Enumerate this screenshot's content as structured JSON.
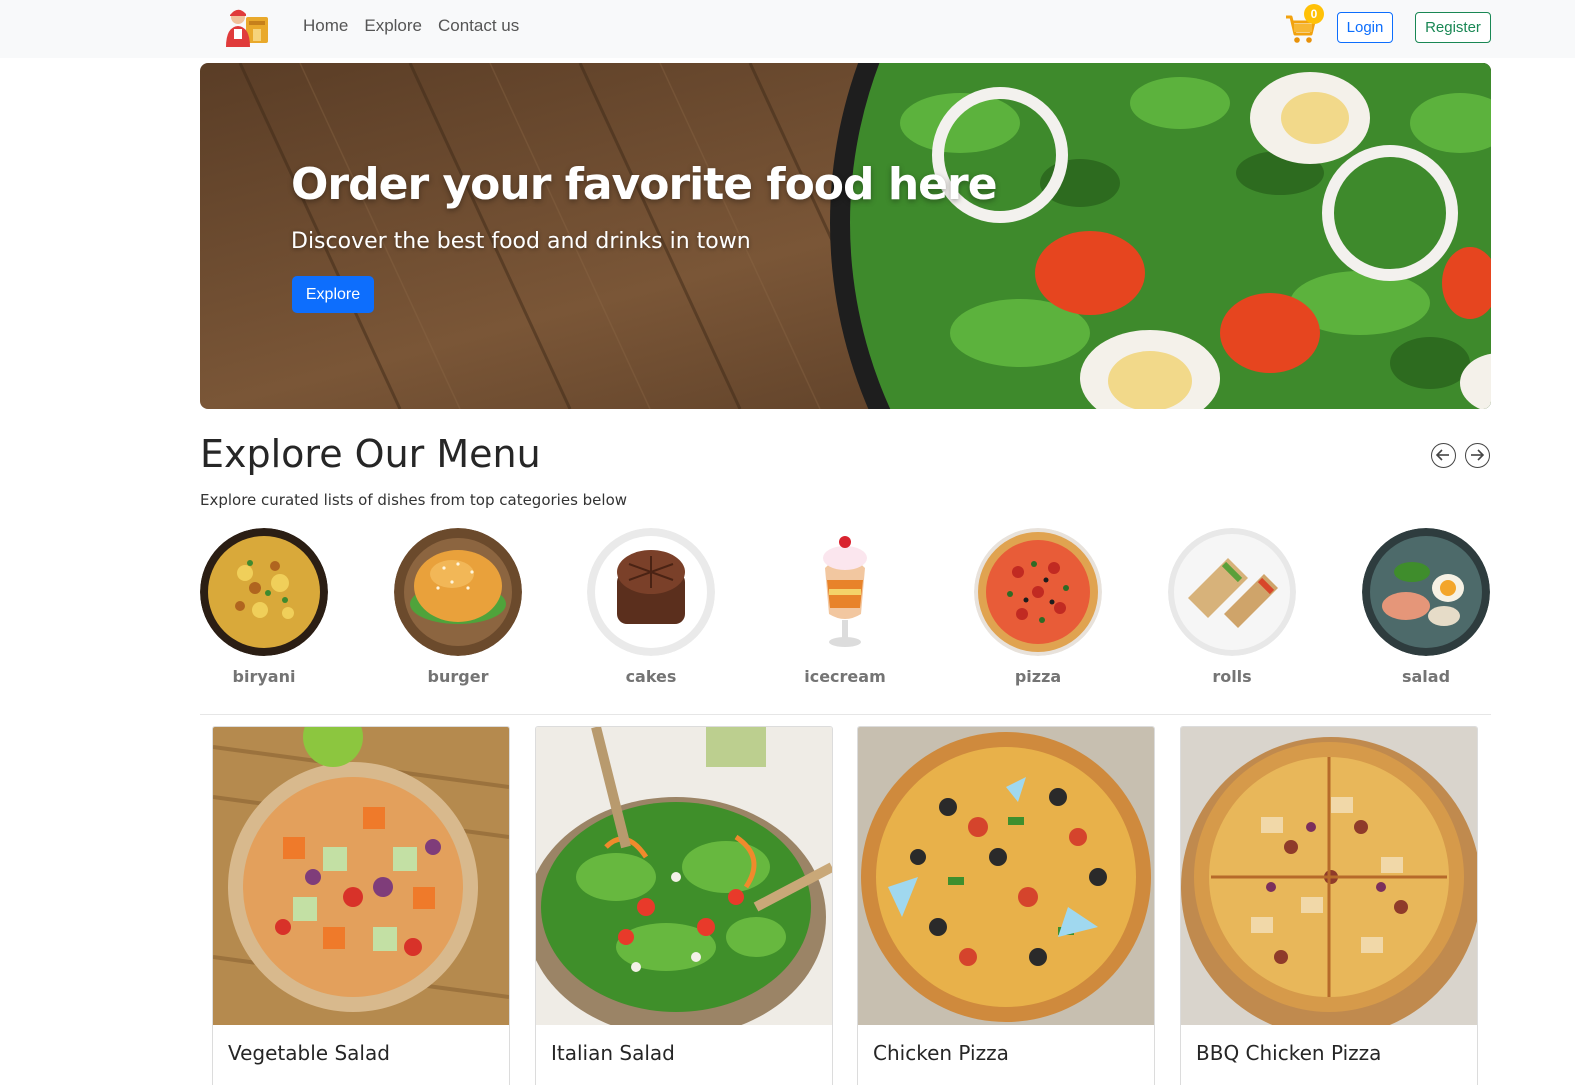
{
  "navbar": {
    "links": [
      "Home",
      "Explore",
      "Contact us"
    ],
    "cart_count": "0",
    "login_label": "Login",
    "register_label": "Register"
  },
  "hero": {
    "title": "Order your favorite food here",
    "subtitle": "Discover the best food and drinks in town",
    "button_label": "Explore"
  },
  "menu": {
    "title": "Explore Our Menu",
    "subtitle": "Explore curated lists of dishes from top categories below",
    "categories": [
      "biryani",
      "burger",
      "cakes",
      "icecream",
      "pizza",
      "rolls",
      "salad"
    ]
  },
  "foods": [
    {
      "name": "Vegetable Salad"
    },
    {
      "name": "Italian Salad"
    },
    {
      "name": "Chicken Pizza"
    },
    {
      "name": "BBQ Chicken Pizza"
    }
  ],
  "colors": {
    "primary": "#0d6efd",
    "success": "#198754",
    "badge": "#ffc107",
    "navbar_bg": "#f8f9fa"
  }
}
